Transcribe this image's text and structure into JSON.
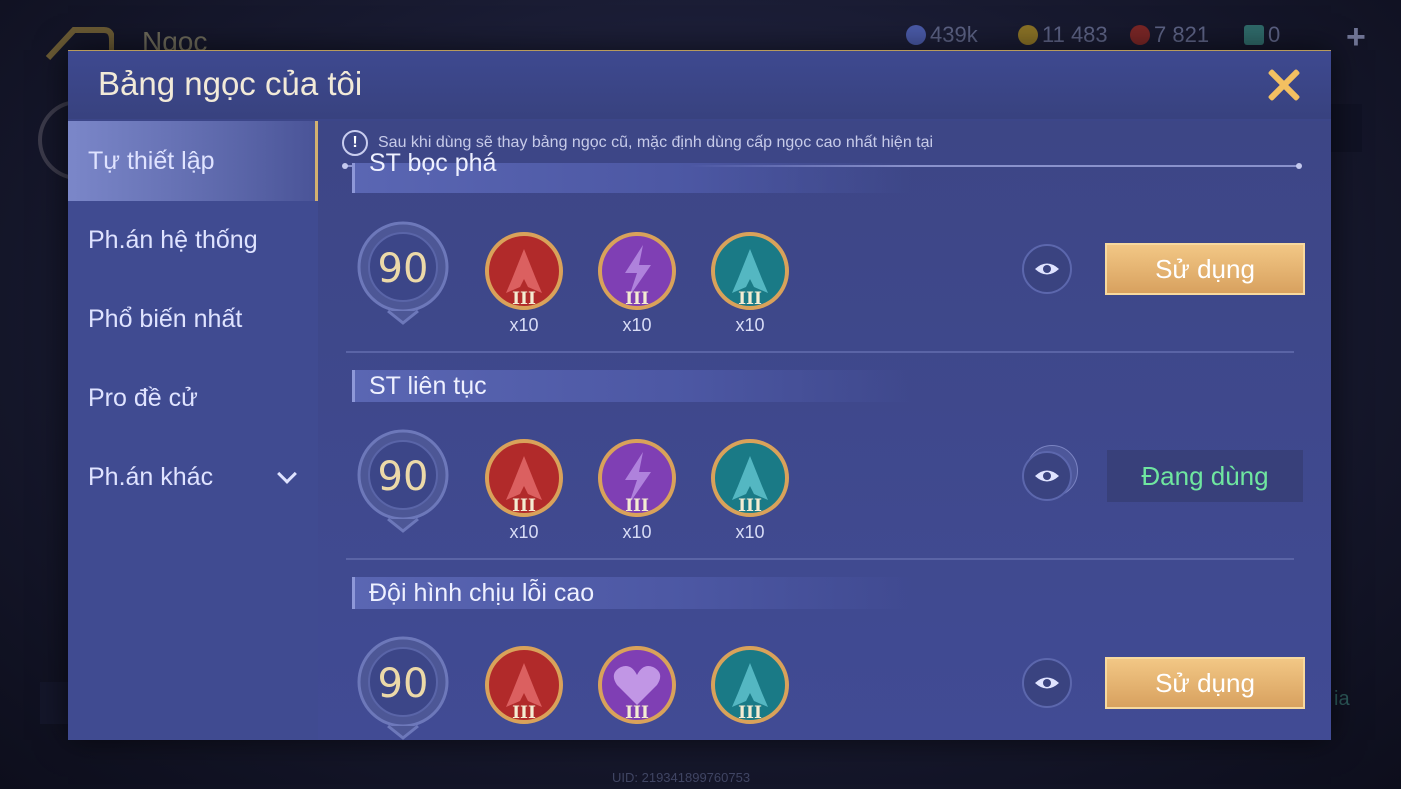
{
  "background": {
    "title": "Ngọc",
    "resources": [
      {
        "value": "439k",
        "color": "#4a5aa8"
      },
      {
        "value": "11 483",
        "color": "#b89632"
      },
      {
        "value": "7 821",
        "color": "#9a2a2a"
      },
      {
        "value": "0",
        "color": "#3a8a8a"
      }
    ],
    "uid": "UID: 219341899760753",
    "right_text": "ia"
  },
  "modal": {
    "title": "Bảng ngọc của tôi",
    "close_label": "close"
  },
  "sidebar": {
    "items": [
      {
        "label": "Tự thiết lập",
        "active": true
      },
      {
        "label": "Ph.án hệ thống",
        "active": false
      },
      {
        "label": "Phổ biến nhất",
        "active": false
      },
      {
        "label": "Pro đề cử",
        "active": false
      },
      {
        "label": "Ph.án khác",
        "active": false,
        "has_dropdown": true
      }
    ]
  },
  "notice": {
    "icon": "!",
    "text": "Sau khi dùng sẽ thay bảng ngọc cũ, mặc định dùng cấp ngọc cao nhất hiện tại"
  },
  "rune_pages": [
    {
      "name": "ST bọc phá",
      "level": "90",
      "gems": [
        {
          "color": "red",
          "icon": "red-rune-icon",
          "tier": "III",
          "count": "x10"
        },
        {
          "color": "purple",
          "icon": "lightning-rune-icon",
          "tier": "III",
          "count": "x10"
        },
        {
          "color": "teal",
          "icon": "teal-rune-icon",
          "tier": "III",
          "count": "x10"
        }
      ],
      "action": "Sử dụng",
      "in_use": false
    },
    {
      "name": "ST liên tục",
      "level": "90",
      "gems": [
        {
          "color": "red",
          "icon": "red-rune-icon",
          "tier": "III",
          "count": "x10"
        },
        {
          "color": "purple",
          "icon": "lightning-rune-icon",
          "tier": "III",
          "count": "x10"
        },
        {
          "color": "teal",
          "icon": "teal-rune-icon",
          "tier": "III",
          "count": "x10"
        }
      ],
      "action": "Đang dùng",
      "in_use": true
    },
    {
      "name": "Đội hình chịu lỗi cao",
      "level": "90",
      "gems": [
        {
          "color": "red",
          "icon": "red-rune-icon",
          "tier": "III",
          "count": ""
        },
        {
          "color": "purple",
          "icon": "heart-rune-icon",
          "tier": "III",
          "count": ""
        },
        {
          "color": "teal",
          "icon": "teal-rune-icon",
          "tier": "III",
          "count": ""
        }
      ],
      "action": "Sử dụng",
      "in_use": false
    }
  ],
  "colors": {
    "gold": "#f3c061",
    "in_use_green": "#6fe6a0",
    "panel": "#3c4689"
  }
}
